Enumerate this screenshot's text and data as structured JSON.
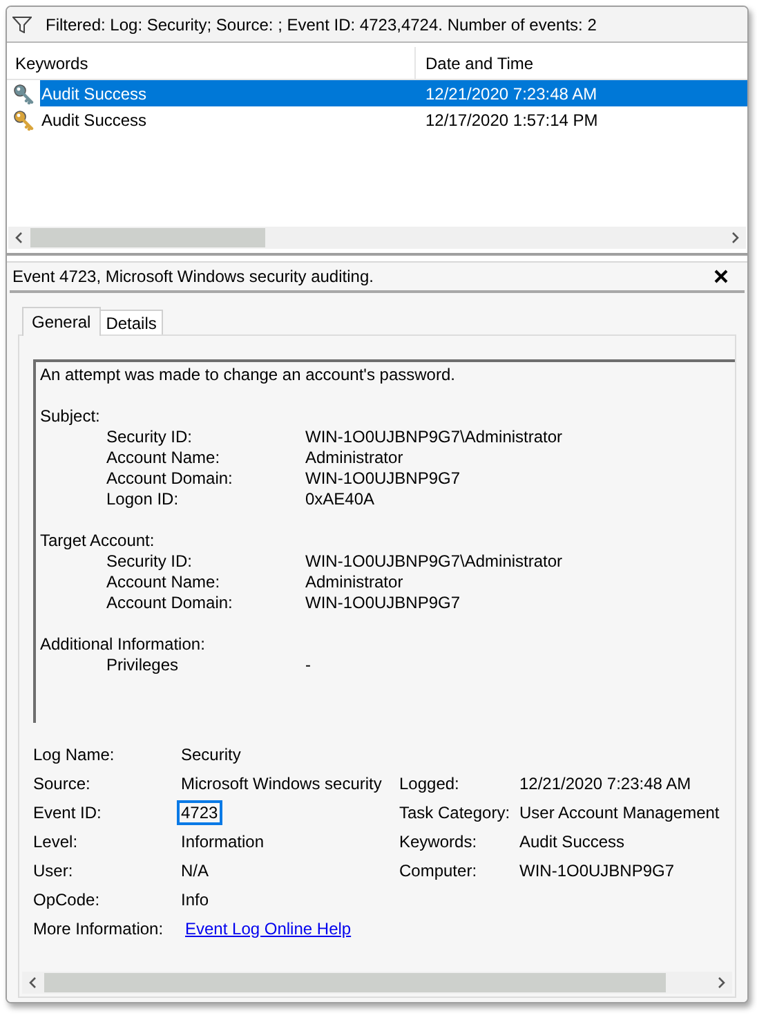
{
  "filter_bar": {
    "text": "Filtered: Log: Security; Source: ; Event ID: 4723,4724. Number of events: 2"
  },
  "event_list": {
    "columns": [
      "Keywords",
      "Date and Time"
    ],
    "rows": [
      {
        "keyword": "Audit Success",
        "date_time": "12/21/2020 7:23:48 AM",
        "selected": true
      },
      {
        "keyword": "Audit Success",
        "date_time": "12/17/2020 1:57:14 PM",
        "selected": false
      }
    ]
  },
  "event_pane": {
    "title": "Event 4723, Microsoft Windows security auditing.",
    "tabs": [
      {
        "label": "General",
        "selected": true
      },
      {
        "label": "Details",
        "selected": false
      }
    ],
    "description": {
      "summary": "An attempt was made to change an account's password.",
      "sections": [
        {
          "heading": "Subject:",
          "fields": [
            {
              "label": "Security ID:",
              "value": "WIN-1O0UJBNP9G7\\Administrator"
            },
            {
              "label": "Account Name:",
              "value": "Administrator"
            },
            {
              "label": "Account Domain:",
              "value": "WIN-1O0UJBNP9G7"
            },
            {
              "label": "Logon ID:",
              "value": "0xAE40A"
            }
          ]
        },
        {
          "heading": "Target Account:",
          "fields": [
            {
              "label": "Security ID:",
              "value": "WIN-1O0UJBNP9G7\\Administrator"
            },
            {
              "label": "Account Name:",
              "value": "Administrator"
            },
            {
              "label": "Account Domain:",
              "value": "WIN-1O0UJBNP9G7"
            }
          ]
        },
        {
          "heading": "Additional Information:",
          "fields": [
            {
              "label": "Privileges",
              "value": "-"
            }
          ]
        }
      ]
    },
    "properties": [
      {
        "label": "Log Name:",
        "value": "Security"
      },
      {
        "label": "Source:",
        "value": "Microsoft Windows security",
        "right_label": "Logged:",
        "right_value": "12/21/2020 7:23:48 AM"
      },
      {
        "label": "Event ID:",
        "value": "4723",
        "focused": true,
        "right_label": "Task Category:",
        "right_value": "User Account Management"
      },
      {
        "label": "Level:",
        "value": "Information",
        "right_label": "Keywords:",
        "right_value": "Audit Success"
      },
      {
        "label": "User:",
        "value": "N/A",
        "right_label": "Computer:",
        "right_value": "WIN-1O0UJBNP9G7"
      },
      {
        "label": "OpCode:",
        "value": "Info"
      },
      {
        "label": "More Information:",
        "value": "Event Log Online Help",
        "kind": "link"
      }
    ]
  }
}
